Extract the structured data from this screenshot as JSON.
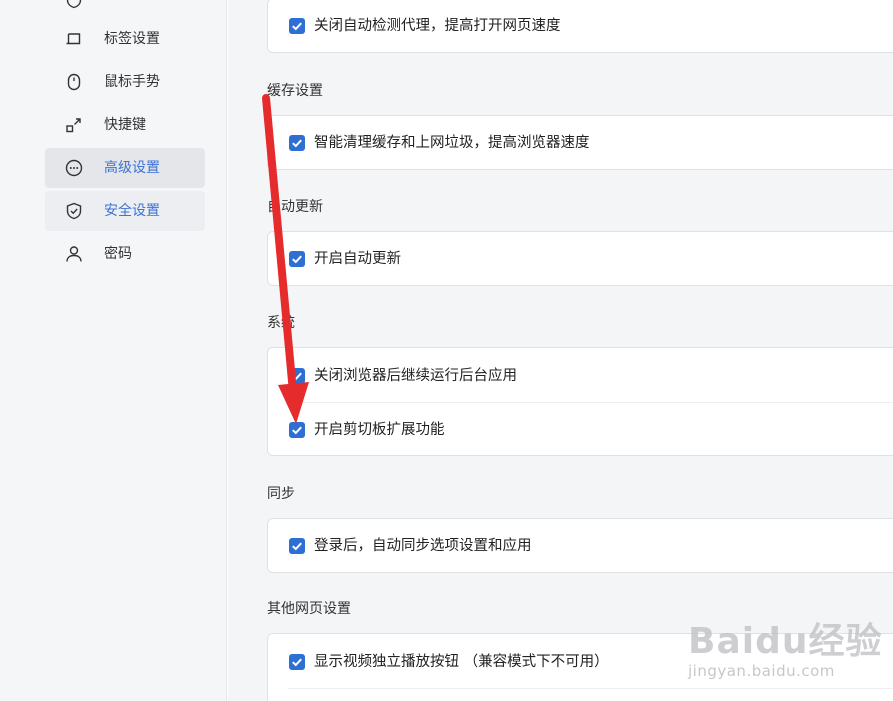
{
  "sidebar": {
    "items": [
      {
        "label": "",
        "icon": "shield-icon",
        "state": "normal"
      },
      {
        "label": "标签设置",
        "icon": "tab-icon",
        "state": "normal"
      },
      {
        "label": "鼠标手势",
        "icon": "mouse-icon",
        "state": "normal"
      },
      {
        "label": "快捷键",
        "icon": "shortcut-icon",
        "state": "normal"
      },
      {
        "label": "高级设置",
        "icon": "more-icon",
        "state": "active"
      },
      {
        "label": "安全设置",
        "icon": "shield-check-icon",
        "state": "hover"
      },
      {
        "label": "密码",
        "icon": "user-icon",
        "state": "normal"
      }
    ]
  },
  "sections": {
    "top": {
      "options": [
        {
          "label": "关闭自动检测代理，提高打开网页速度",
          "checked": true
        }
      ]
    },
    "cache": {
      "title": "缓存设置",
      "options": [
        {
          "label": "智能清理缓存和上网垃圾，提高浏览器速度",
          "checked": true
        }
      ]
    },
    "update": {
      "title": "自动更新",
      "options": [
        {
          "label": "开启自动更新",
          "checked": true
        }
      ]
    },
    "system": {
      "title": "系统",
      "options": [
        {
          "label": "关闭浏览器后继续运行后台应用",
          "checked": true
        },
        {
          "label": "开启剪切板扩展功能",
          "checked": true
        }
      ]
    },
    "sync": {
      "title": "同步",
      "options": [
        {
          "label": "登录后，自动同步选项设置和应用",
          "checked": true
        }
      ]
    },
    "web": {
      "title": "其他网页设置",
      "options": [
        {
          "label": "显示视频独立播放按钮 （兼容模式下不可用）",
          "checked": true
        }
      ]
    }
  },
  "colors": {
    "accent": "#2d6fd3",
    "arrow": "#e52b2b",
    "active_text": "#3b73d6"
  },
  "watermark": {
    "brand": "Baidu经验",
    "url": "jingyan.baidu.com"
  }
}
